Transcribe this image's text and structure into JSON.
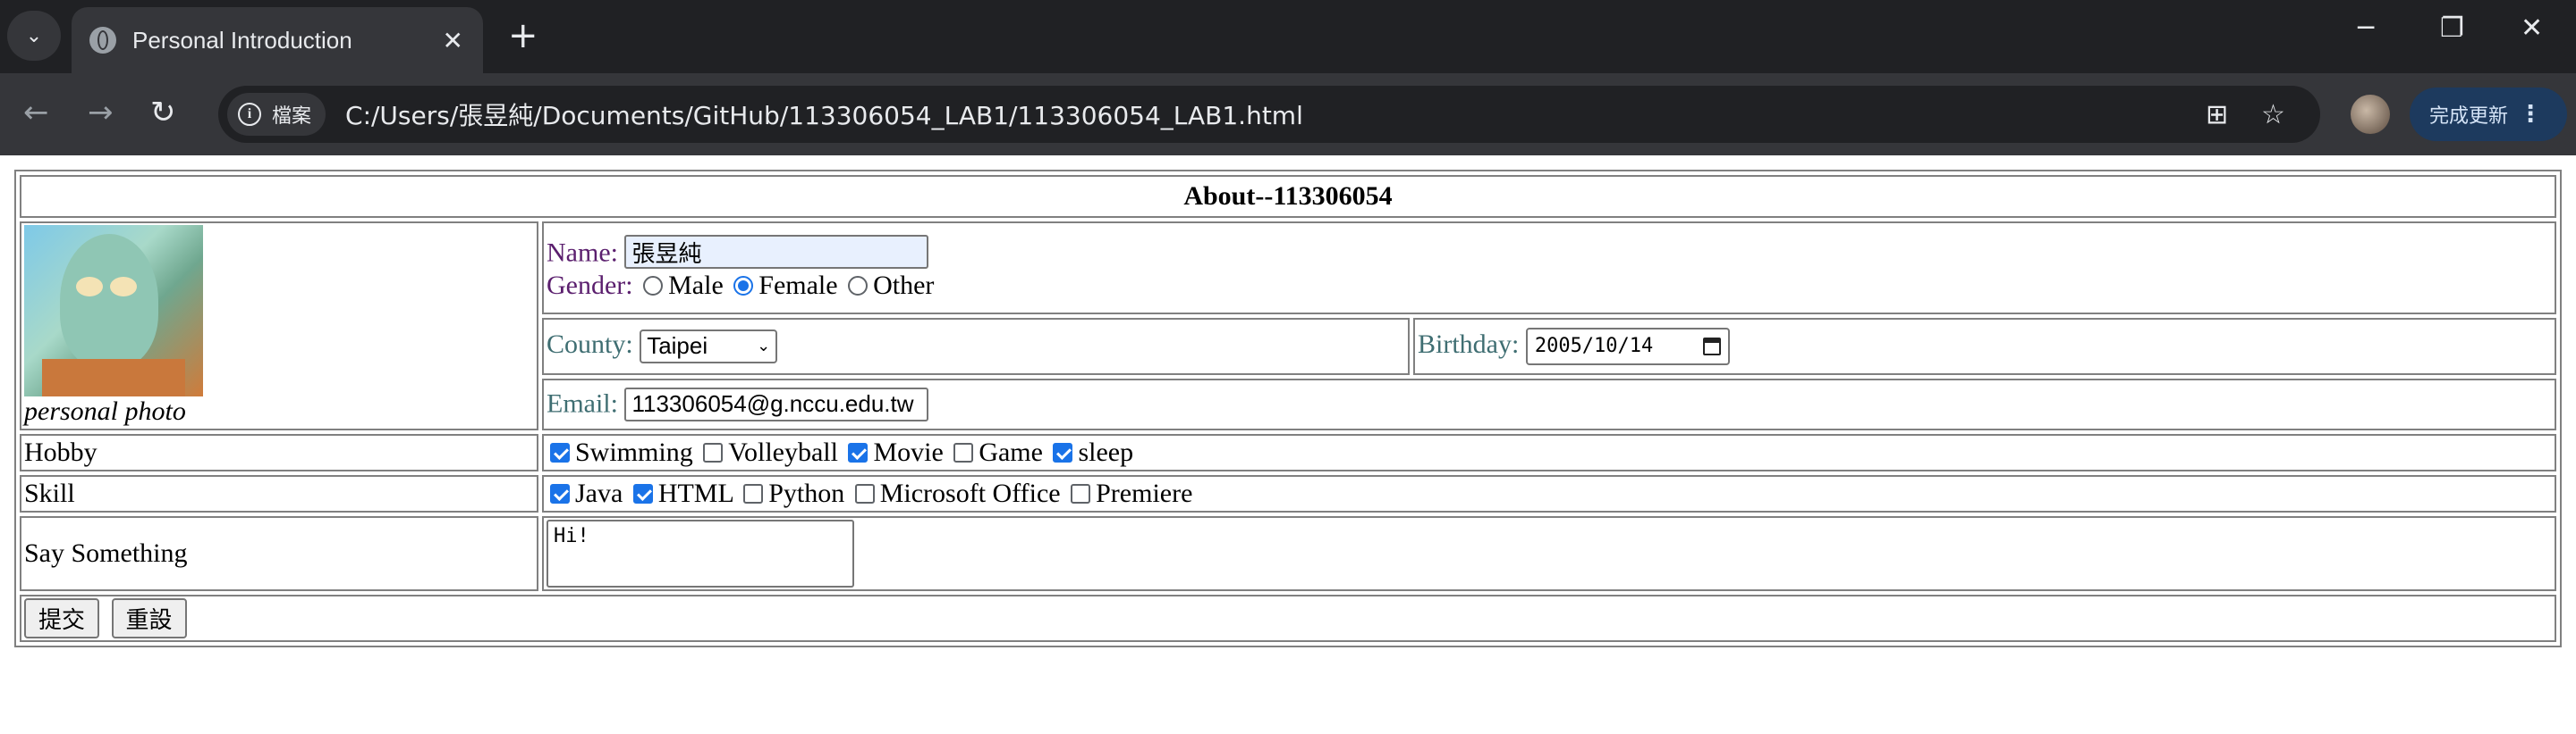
{
  "browser": {
    "tab_title": "Personal Introduction",
    "site_chip": "檔案",
    "url": "C:/Users/張昱純/Documents/GitHub/113306054_LAB1/113306054_LAB1.html",
    "update_label": "完成更新"
  },
  "form": {
    "caption": "About--113306054",
    "photo_caption": "personal photo",
    "name_label": "Name:",
    "name_value": "張昱純",
    "gender_label": "Gender:",
    "gender_options": [
      "Male",
      "Female",
      "Other"
    ],
    "gender_selected": "Female",
    "county_label": "County:",
    "county_value": "Taipei",
    "birthday_label": "Birthday:",
    "birthday_value": "2005/10/14",
    "email_label": "Email:",
    "email_value": "113306054@g.nccu.edu.tw",
    "hobby_label": "Hobby",
    "hobbies": [
      {
        "label": "Swimming",
        "checked": true
      },
      {
        "label": "Volleyball",
        "checked": false
      },
      {
        "label": "Movie",
        "checked": true
      },
      {
        "label": "Game",
        "checked": false
      },
      {
        "label": "sleep",
        "checked": true
      }
    ],
    "skill_label": "Skill",
    "skills": [
      {
        "label": "Java",
        "checked": true
      },
      {
        "label": "HTML",
        "checked": true
      },
      {
        "label": "Python",
        "checked": false
      },
      {
        "label": "Microsoft Office",
        "checked": false
      },
      {
        "label": "Premiere",
        "checked": false
      }
    ],
    "say_label": "Say Something",
    "say_value": "Hi!",
    "submit_label": "提交",
    "reset_label": "重設"
  }
}
